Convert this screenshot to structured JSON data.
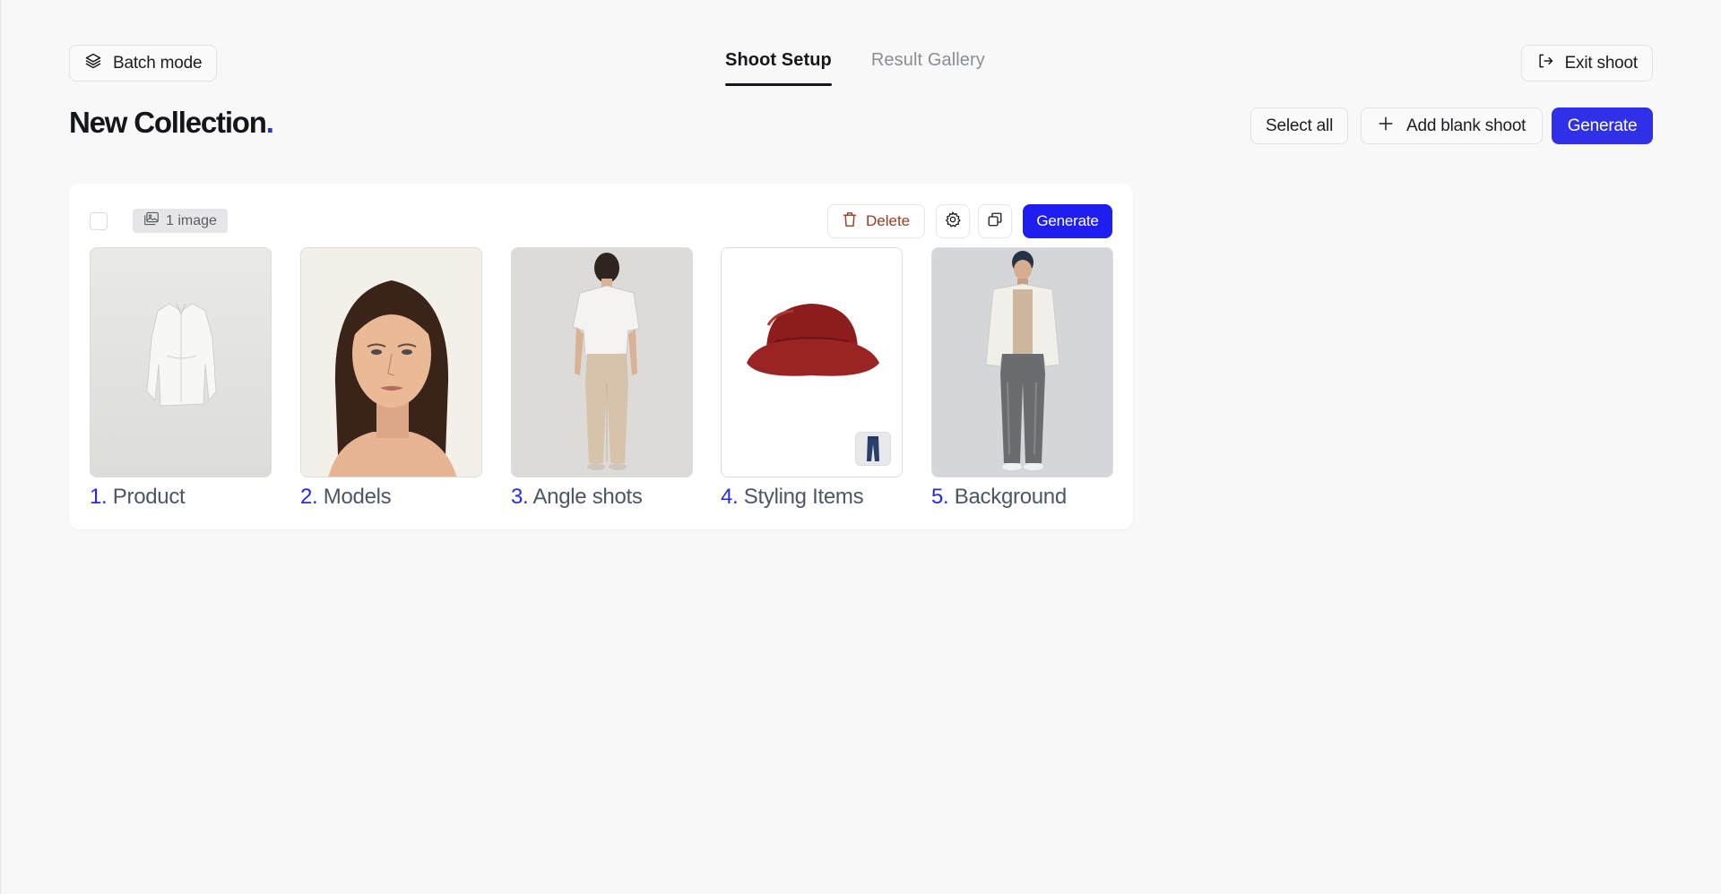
{
  "header": {
    "batch_mode_label": "Batch mode",
    "exit_label": "Exit shoot",
    "tabs": [
      {
        "label": "Shoot Setup",
        "active": true
      },
      {
        "label": "Result Gallery",
        "active": false
      }
    ]
  },
  "page": {
    "title": "New Collection",
    "title_dot": ".",
    "actions": {
      "select_all_label": "Select all",
      "add_blank_label": "Add blank shoot",
      "generate_label": "Generate"
    }
  },
  "shoot_card": {
    "image_count_label": "1 image",
    "delete_label": "Delete",
    "generate_label": "Generate",
    "slots": [
      {
        "num": "1.",
        "label": "Product",
        "image": "white-shirt-photo"
      },
      {
        "num": "2.",
        "label": "Models",
        "image": "model-portrait-photo"
      },
      {
        "num": "3.",
        "label": "Angle shots",
        "image": "back-pose-photo"
      },
      {
        "num": "4.",
        "label": "Styling Items",
        "image": "red-fur-bucket-hat-photo",
        "badge": "jeans-thumbnail"
      },
      {
        "num": "5.",
        "label": "Background",
        "image": "full-body-model-photo"
      }
    ]
  },
  "colors": {
    "accent": "#3030e8",
    "card_generate": "#1e1ef0",
    "delete_text": "#9a3c22",
    "page_bg": "#f8f8f8"
  }
}
